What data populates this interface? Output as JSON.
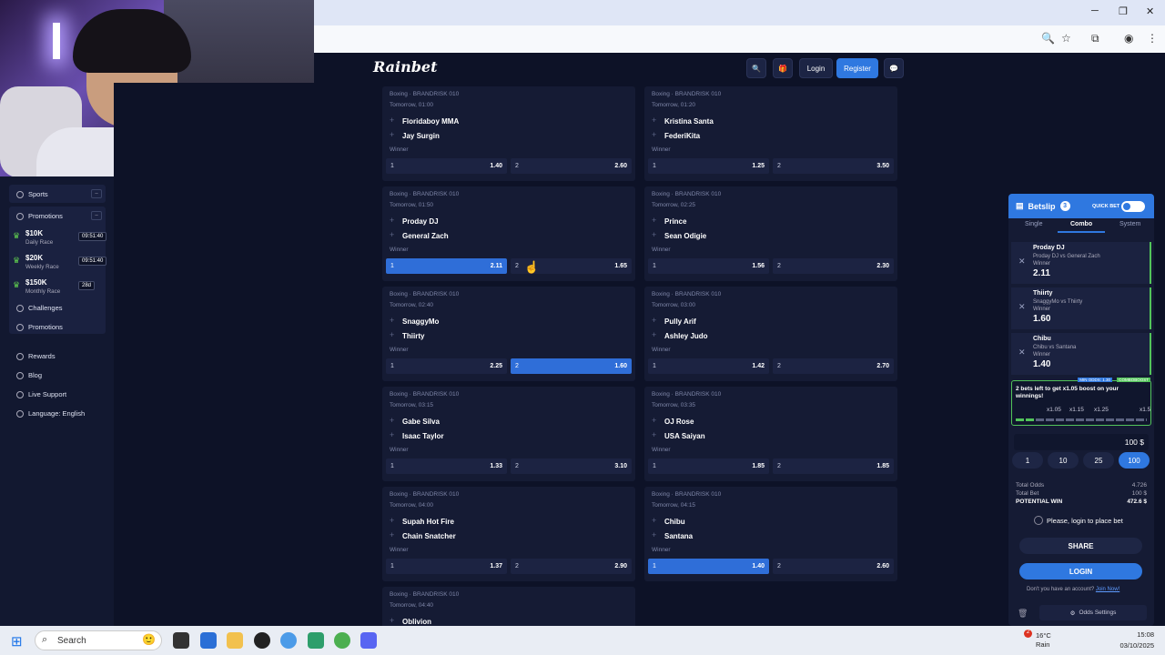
{
  "site": {
    "logo": "Rainbet",
    "login": "Login",
    "register": "Register"
  },
  "nav": {
    "sports": "Sports",
    "promotions": "Promotions",
    "collapse": "–",
    "races": [
      {
        "amount": "$10K",
        "label": "Daily Race",
        "timer": "09:51:40"
      },
      {
        "amount": "$20K",
        "label": "Weekly Race",
        "timer": "09:51:40"
      },
      {
        "amount": "$150K",
        "label": "Monthly Race",
        "timer": "28d"
      }
    ],
    "challenges": "Challenges",
    "promotions2": "Promotions",
    "rewards": "Rewards",
    "blog": "Blog",
    "support": "Live Support",
    "language": "Language: English"
  },
  "matches": [
    {
      "league": "Boxing · BRANDRISK 010",
      "time": "Tomorrow, 01:00",
      "home": "Floridaboy MMA",
      "away": "Jay Surgin",
      "market": "Winner",
      "o1": "1.40",
      "o2": "2.60",
      "sel": 0
    },
    {
      "league": "Boxing · BRANDRISK 010",
      "time": "Tomorrow, 01:20",
      "home": "Kristina Santa",
      "away": "FederiKita",
      "market": "Winner",
      "o1": "1.25",
      "o2": "3.50",
      "sel": 0
    },
    {
      "league": "Boxing · BRANDRISK 010",
      "time": "Tomorrow, 01:50",
      "home": "Proday DJ",
      "away": "General Zach",
      "market": "Winner",
      "o1": "2.11",
      "o2": "1.65",
      "sel": 1
    },
    {
      "league": "Boxing · BRANDRISK 010",
      "time": "Tomorrow, 02:25",
      "home": "Prince",
      "away": "Sean Odigie",
      "market": "Winner",
      "o1": "1.56",
      "o2": "2.30",
      "sel": 0
    },
    {
      "league": "Boxing · BRANDRISK 010",
      "time": "Tomorrow, 02:40",
      "home": "SnaggyMo",
      "away": "Thiirty",
      "market": "Winner",
      "o1": "2.25",
      "o2": "1.60",
      "sel": 2
    },
    {
      "league": "Boxing · BRANDRISK 010",
      "time": "Tomorrow, 03:00",
      "home": "Pully Arif",
      "away": "Ashley Judo",
      "market": "Winner",
      "o1": "1.42",
      "o2": "2.70",
      "sel": 0
    },
    {
      "league": "Boxing · BRANDRISK 010",
      "time": "Tomorrow, 03:15",
      "home": "Gabe Silva",
      "away": "Isaac Taylor",
      "market": "Winner",
      "o1": "1.33",
      "o2": "3.10",
      "sel": 0
    },
    {
      "league": "Boxing · BRANDRISK 010",
      "time": "Tomorrow, 03:35",
      "home": "OJ Rose",
      "away": "USA Saiyan",
      "market": "Winner",
      "o1": "1.85",
      "o2": "1.85",
      "sel": 0
    },
    {
      "league": "Boxing · BRANDRISK 010",
      "time": "Tomorrow, 04:00",
      "home": "Supah Hot Fire",
      "away": "Chain Snatcher",
      "market": "Winner",
      "o1": "1.37",
      "o2": "2.90",
      "sel": 0
    },
    {
      "league": "Boxing · BRANDRISK 010",
      "time": "Tomorrow, 04:15",
      "home": "Chibu",
      "away": "Santana",
      "market": "Winner",
      "o1": "1.40",
      "o2": "2.60",
      "sel": 1
    },
    {
      "league": "Boxing · BRANDRISK 010",
      "time": "Tomorrow, 04:40",
      "home": "Oblivion",
      "away": "",
      "market": "",
      "o1": "",
      "o2": "",
      "sel": 0
    }
  ],
  "outcome_labels": {
    "home": "1",
    "away": "2"
  },
  "betslip": {
    "title": "Betslip",
    "count": "3",
    "quick": "QUICK BET",
    "tabs": [
      "Single",
      "Combo",
      "System"
    ],
    "bets": [
      {
        "name": "Proday DJ",
        "match": "Proday DJ vs General Zach",
        "market": "Winner",
        "odds": "2.11"
      },
      {
        "name": "Thiirty",
        "match": "SnaggyMo vs Thiirty",
        "market": "Winner",
        "odds": "1.60"
      },
      {
        "name": "Chibu",
        "match": "Chibu vs Santana",
        "market": "Winner",
        "odds": "1.40"
      }
    ],
    "min_odds": "MIN ODDS: 1.30",
    "combo_boost": "COMBOBOOST",
    "boost_text": "2 bets left to get x1.05 boost on your winnings!",
    "boost_levels": [
      "x1.05",
      "x1.15",
      "x1.25",
      "x1.5"
    ],
    "stake": "100 $",
    "chips": [
      "1",
      "10",
      "25",
      "100"
    ],
    "total_odds_label": "Total Odds",
    "total_odds": "4.726",
    "total_bet_label": "Total Bet",
    "total_bet": "100 $",
    "potential_label": "POTENTIAL WIN",
    "potential": "472.6 $",
    "login_prompt": "Please, login to place bet",
    "share": "SHARE",
    "login": "LOGIN",
    "no_account": "Don't you have an account?",
    "join": "Join Now!",
    "odds_settings": "Odds Settings"
  },
  "taskbar": {
    "search": "Search",
    "temp": "16°C",
    "weather": "Rain",
    "weather_badge": "2",
    "time": "15:08",
    "date": "03/10/2025"
  }
}
